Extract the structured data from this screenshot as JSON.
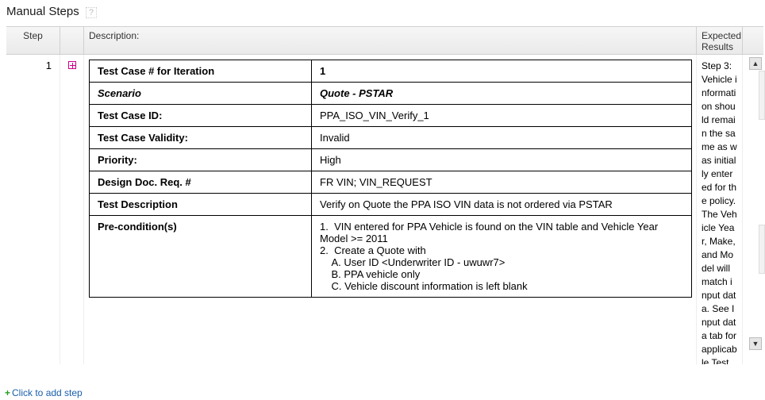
{
  "page": {
    "title": "Manual Steps"
  },
  "columns": {
    "step": "Step",
    "description": "Description:",
    "expected": "Expected Results"
  },
  "row": {
    "step_no": "1",
    "expected_text": "Step 3: Vehicle information should remain the same as was initially entered for the policy. The Vehicle Year, Make, and Model will match input data. See Input data tab for applicable Test C"
  },
  "desc_table": {
    "test_case_iter_label": "Test Case # for Iteration",
    "test_case_iter_val": "1",
    "scenario_label": "Scenario",
    "scenario_val": "Quote - PSTAR",
    "test_case_id_label": "Test Case ID:",
    "test_case_id_val": "PPA_ISO_VIN_Verify_1",
    "validity_label": "Test Case Validity:",
    "validity_val": "Invalid",
    "priority_label": "Priority:",
    "priority_val": "High",
    "design_req_label": "Design Doc. Req. #",
    "design_req_val": "FR VIN; VIN_REQUEST",
    "test_desc_label": "Test Description",
    "test_desc_val": "Verify on Quote the PPA ISO VIN data is not ordered via PSTAR",
    "precond_label": "Pre-condition(s)",
    "precond_val": "1.  VIN entered for PPA Vehicle is found on the VIN table and Vehicle Year Model >= 2011\n2.  Create a Quote with\n    A. User ID <Underwriter ID - uwuwr7>\n    B. PPA vehicle only\n    C. Vehicle discount information is left blank"
  },
  "footer": {
    "add_step": "Click to add step"
  }
}
